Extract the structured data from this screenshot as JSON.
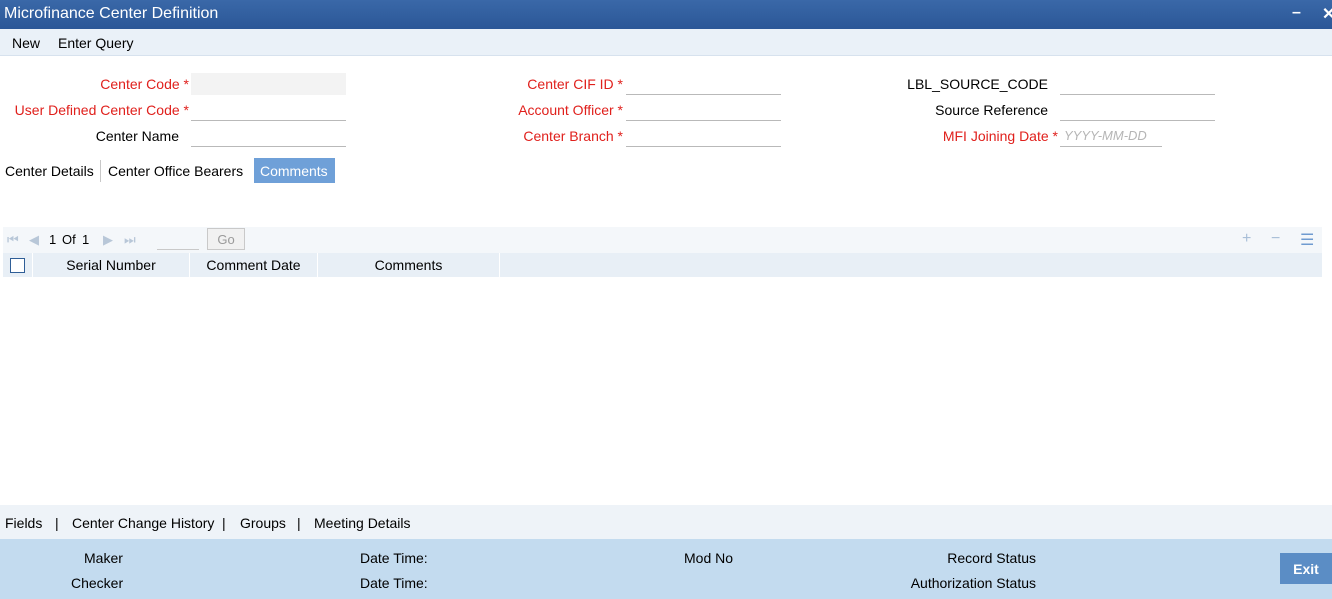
{
  "window": {
    "title": "Microfinance Center Definition",
    "minimize": "–",
    "close": "✕"
  },
  "toolbar": {
    "new_label": "New",
    "enter_query_label": "Enter Query"
  },
  "form": {
    "center_code": {
      "label": "Center Code",
      "required": "*",
      "value": ""
    },
    "user_defined_center_code": {
      "label": "User Defined Center Code",
      "required": "*",
      "value": ""
    },
    "center_name": {
      "label": "Center Name",
      "value": ""
    },
    "center_cif_id": {
      "label": "Center CIF ID",
      "required": "*",
      "value": ""
    },
    "account_officer": {
      "label": "Account Officer",
      "required": "*",
      "value": ""
    },
    "center_branch": {
      "label": "Center Branch",
      "required": "*",
      "value": ""
    },
    "source_code": {
      "label": "LBL_SOURCE_CODE",
      "value": ""
    },
    "source_reference": {
      "label": "Source Reference",
      "value": ""
    },
    "mfi_joining_date": {
      "label": "MFI Joining Date",
      "required": "*",
      "value": "",
      "placeholder": "YYYY-MM-DD"
    }
  },
  "tabs": [
    {
      "label": "Center Details",
      "active": false
    },
    {
      "label": "Center Office Bearers",
      "active": false
    },
    {
      "label": "Comments",
      "active": true
    }
  ],
  "grid": {
    "page_current": "1",
    "page_of": "Of",
    "page_total": "1",
    "go_label": "Go",
    "columns": [
      "Serial Number",
      "Comment Date",
      "Comments"
    ],
    "rows": []
  },
  "links": [
    "Fields",
    "Center Change History",
    "Groups",
    "Meeting Details"
  ],
  "link_separator": "|",
  "footer": {
    "maker_label": "Maker",
    "checker_label": "Checker",
    "date_time_label": "Date Time:",
    "mod_no_label": "Mod No",
    "record_status_label": "Record Status",
    "authorization_status_label": "Authorization Status",
    "exit_label": "Exit"
  },
  "colors": {
    "titlebar": "#2b5797",
    "required": "#e0201c",
    "active_tab": "#6fa0d8",
    "footer": "#c3dbef",
    "exit_button": "#5b8dc5"
  }
}
